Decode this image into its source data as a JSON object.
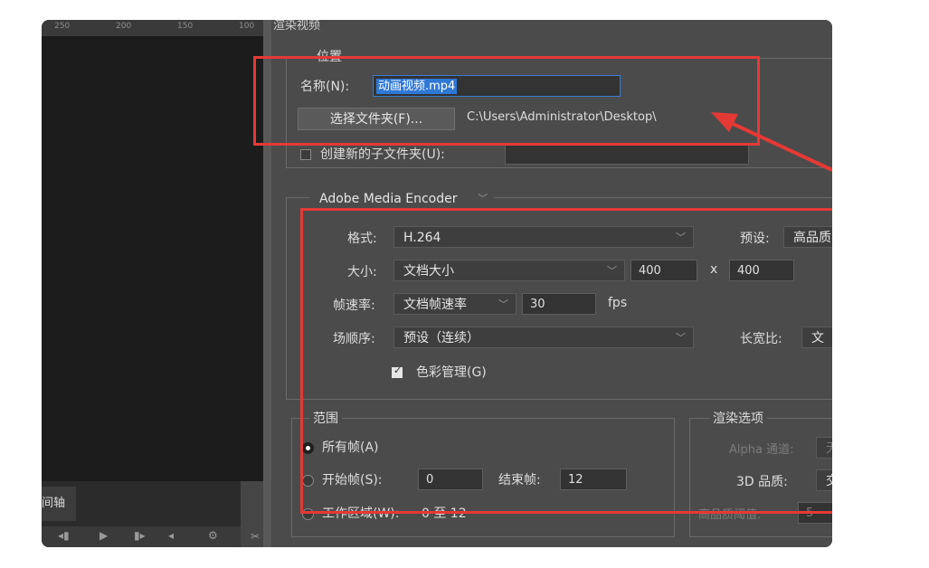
{
  "ruler": {
    "ticks": [
      "250",
      "200",
      "150",
      "100"
    ]
  },
  "timeline": {
    "tab_label": "间轴",
    "controls": [
      "◂▮",
      "▶",
      "▮▸",
      "◂",
      "⚙",
      "✂"
    ]
  },
  "dialog": {
    "title": "渲染视频",
    "location": {
      "legend": "位置",
      "name_label": "名称(N):",
      "name_value": "动画视频.mp4",
      "choose_folder_label": "选择文件夹(F)...",
      "folder_path": "C:\\Users\\Administrator\\Desktop\\",
      "create_subfolder_label": "创建新的子文件夹(U):",
      "create_subfolder_checked": false
    },
    "encoder": {
      "selected": "Adobe Media Encoder",
      "format_label": "格式:",
      "format_value": "H.264",
      "preset_label": "预设:",
      "preset_value": "高品质",
      "size_label": "大小:",
      "size_value": "文档大小",
      "width": "400",
      "x_label": "x",
      "height": "400",
      "framerate_label": "帧速率:",
      "framerate_value": "文档帧速率",
      "fps_value": "30",
      "fps_unit": "fps",
      "field_order_label": "场顺序:",
      "field_order_value": "预设（连续）",
      "aspect_label": "长宽比:",
      "aspect_value": "文",
      "color_mgmt_label": "色彩管理(G)",
      "color_mgmt_checked": true
    },
    "range": {
      "legend": "范围",
      "all_frames_label": "所有帧(A)",
      "start_frame_label": "开始帧(S):",
      "start_frame_value": "0",
      "end_frame_label": "结束帧:",
      "end_frame_value": "12",
      "work_area_label": "工作区域(W):",
      "work_area_value": "0 至 12"
    },
    "render_options": {
      "legend": "渲染选项",
      "alpha_label": "Alpha 通道:",
      "alpha_value": "无",
      "quality_label": "3D 品质:",
      "quality_value": "交",
      "threshold_label": "高品质阈值:",
      "threshold_value": "5"
    }
  },
  "colors": {
    "annotation": "#e53935",
    "dialog_bg": "#4b4b4b",
    "selection": "#2e78d6"
  }
}
